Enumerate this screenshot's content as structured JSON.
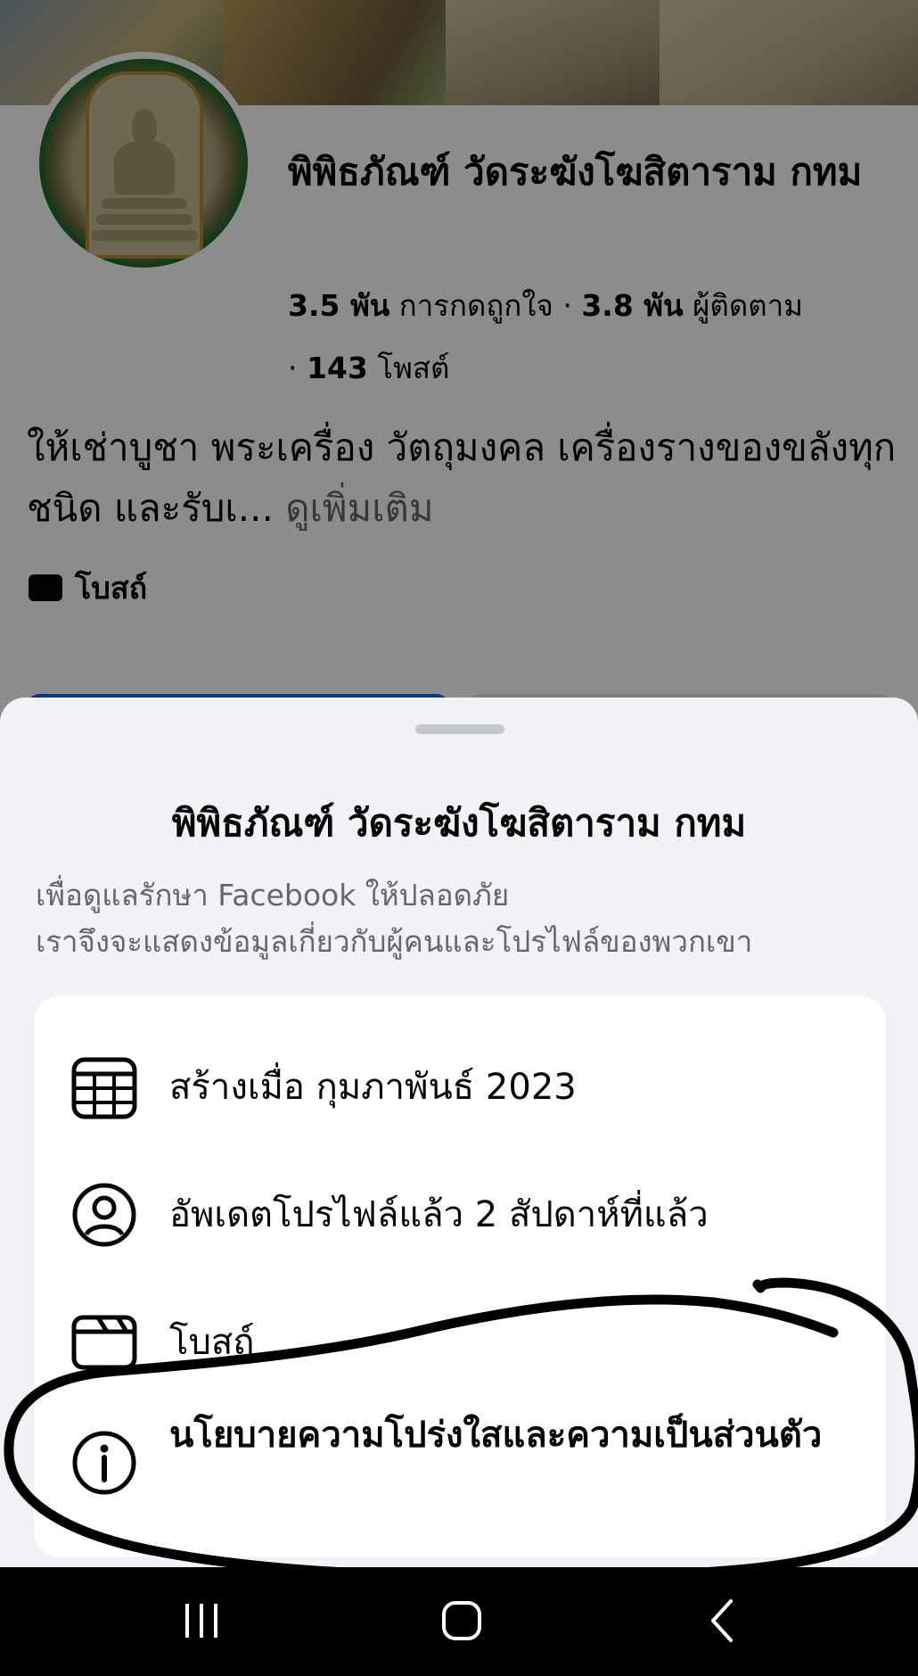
{
  "page": {
    "name": "พิพิธภัณฑ์ วัดระฆังโฆสิตาราม กทม",
    "likes_value": "3.5 พัน",
    "likes_label": "การกดถูกใจ",
    "followers_value": "3.8 พัน",
    "followers_label": "ผู้ติดตาม",
    "posts_value": "143",
    "posts_label": "โพสต์",
    "separator": "·",
    "bio": "ให้เช่าบูชา พระเครื่อง วัตถุมงคล เครื่องรางของขลังทุกชนิด และรับเ...",
    "see_more": "ดูเพิ่มเติม",
    "category": "โบสถ์"
  },
  "sheet": {
    "title": "พิพิธภัณฑ์ วัดระฆังโฆสิตาราม กทม",
    "description_line1": "เพื่อดูแลรักษา Facebook ให้ปลอดภัย",
    "description_line2": "เราจึงจะแสดงข้อมูลเกี่ยวกับผู้คนและโปรไฟล์ของพวกเขา",
    "items": [
      {
        "icon": "calendar-icon",
        "label": "สร้างเมื่อ กุมภาพันธ์ 2023"
      },
      {
        "icon": "profile-icon",
        "label": "อัพเดตโปรไฟล์แล้ว 2 สัปดาห์ที่แล้ว"
      },
      {
        "icon": "category-icon",
        "label": "โบสถ์"
      },
      {
        "icon": "info-icon",
        "label": "นโยบายความโปร่งใสและความเป็นส่วนตัว"
      }
    ]
  },
  "navbar": {
    "buttons": [
      "recent-apps-icon",
      "home-icon",
      "back-icon"
    ]
  },
  "colors": {
    "primary": "#0866ff",
    "sheet_bg": "#f0f2f5",
    "muted_text": "#65676b",
    "annotation_ink": "#000000"
  }
}
